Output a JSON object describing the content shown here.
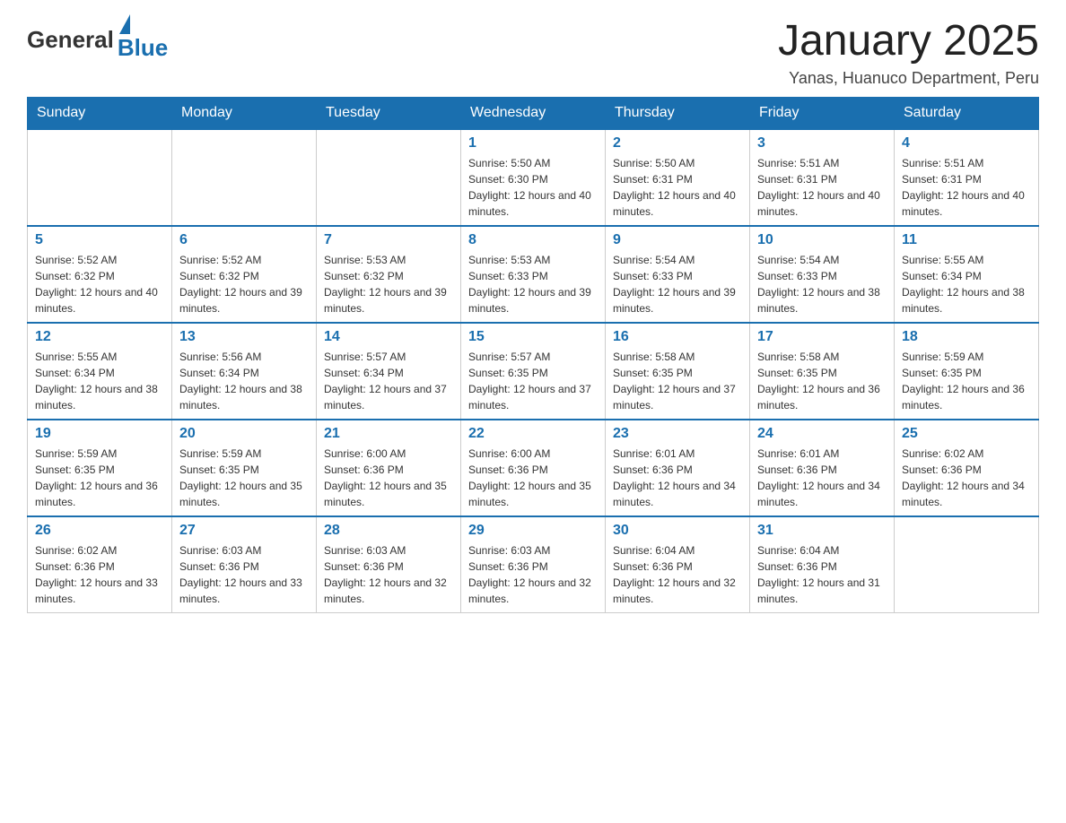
{
  "header": {
    "logo_general": "General",
    "logo_blue": "Blue",
    "title": "January 2025",
    "subtitle": "Yanas, Huanuco Department, Peru"
  },
  "columns": [
    "Sunday",
    "Monday",
    "Tuesday",
    "Wednesday",
    "Thursday",
    "Friday",
    "Saturday"
  ],
  "weeks": [
    [
      {
        "day": "",
        "info": ""
      },
      {
        "day": "",
        "info": ""
      },
      {
        "day": "",
        "info": ""
      },
      {
        "day": "1",
        "info": "Sunrise: 5:50 AM\nSunset: 6:30 PM\nDaylight: 12 hours and 40 minutes."
      },
      {
        "day": "2",
        "info": "Sunrise: 5:50 AM\nSunset: 6:31 PM\nDaylight: 12 hours and 40 minutes."
      },
      {
        "day": "3",
        "info": "Sunrise: 5:51 AM\nSunset: 6:31 PM\nDaylight: 12 hours and 40 minutes."
      },
      {
        "day": "4",
        "info": "Sunrise: 5:51 AM\nSunset: 6:31 PM\nDaylight: 12 hours and 40 minutes."
      }
    ],
    [
      {
        "day": "5",
        "info": "Sunrise: 5:52 AM\nSunset: 6:32 PM\nDaylight: 12 hours and 40 minutes."
      },
      {
        "day": "6",
        "info": "Sunrise: 5:52 AM\nSunset: 6:32 PM\nDaylight: 12 hours and 39 minutes."
      },
      {
        "day": "7",
        "info": "Sunrise: 5:53 AM\nSunset: 6:32 PM\nDaylight: 12 hours and 39 minutes."
      },
      {
        "day": "8",
        "info": "Sunrise: 5:53 AM\nSunset: 6:33 PM\nDaylight: 12 hours and 39 minutes."
      },
      {
        "day": "9",
        "info": "Sunrise: 5:54 AM\nSunset: 6:33 PM\nDaylight: 12 hours and 39 minutes."
      },
      {
        "day": "10",
        "info": "Sunrise: 5:54 AM\nSunset: 6:33 PM\nDaylight: 12 hours and 38 minutes."
      },
      {
        "day": "11",
        "info": "Sunrise: 5:55 AM\nSunset: 6:34 PM\nDaylight: 12 hours and 38 minutes."
      }
    ],
    [
      {
        "day": "12",
        "info": "Sunrise: 5:55 AM\nSunset: 6:34 PM\nDaylight: 12 hours and 38 minutes."
      },
      {
        "day": "13",
        "info": "Sunrise: 5:56 AM\nSunset: 6:34 PM\nDaylight: 12 hours and 38 minutes."
      },
      {
        "day": "14",
        "info": "Sunrise: 5:57 AM\nSunset: 6:34 PM\nDaylight: 12 hours and 37 minutes."
      },
      {
        "day": "15",
        "info": "Sunrise: 5:57 AM\nSunset: 6:35 PM\nDaylight: 12 hours and 37 minutes."
      },
      {
        "day": "16",
        "info": "Sunrise: 5:58 AM\nSunset: 6:35 PM\nDaylight: 12 hours and 37 minutes."
      },
      {
        "day": "17",
        "info": "Sunrise: 5:58 AM\nSunset: 6:35 PM\nDaylight: 12 hours and 36 minutes."
      },
      {
        "day": "18",
        "info": "Sunrise: 5:59 AM\nSunset: 6:35 PM\nDaylight: 12 hours and 36 minutes."
      }
    ],
    [
      {
        "day": "19",
        "info": "Sunrise: 5:59 AM\nSunset: 6:35 PM\nDaylight: 12 hours and 36 minutes."
      },
      {
        "day": "20",
        "info": "Sunrise: 5:59 AM\nSunset: 6:35 PM\nDaylight: 12 hours and 35 minutes."
      },
      {
        "day": "21",
        "info": "Sunrise: 6:00 AM\nSunset: 6:36 PM\nDaylight: 12 hours and 35 minutes."
      },
      {
        "day": "22",
        "info": "Sunrise: 6:00 AM\nSunset: 6:36 PM\nDaylight: 12 hours and 35 minutes."
      },
      {
        "day": "23",
        "info": "Sunrise: 6:01 AM\nSunset: 6:36 PM\nDaylight: 12 hours and 34 minutes."
      },
      {
        "day": "24",
        "info": "Sunrise: 6:01 AM\nSunset: 6:36 PM\nDaylight: 12 hours and 34 minutes."
      },
      {
        "day": "25",
        "info": "Sunrise: 6:02 AM\nSunset: 6:36 PM\nDaylight: 12 hours and 34 minutes."
      }
    ],
    [
      {
        "day": "26",
        "info": "Sunrise: 6:02 AM\nSunset: 6:36 PM\nDaylight: 12 hours and 33 minutes."
      },
      {
        "day": "27",
        "info": "Sunrise: 6:03 AM\nSunset: 6:36 PM\nDaylight: 12 hours and 33 minutes."
      },
      {
        "day": "28",
        "info": "Sunrise: 6:03 AM\nSunset: 6:36 PM\nDaylight: 12 hours and 32 minutes."
      },
      {
        "day": "29",
        "info": "Sunrise: 6:03 AM\nSunset: 6:36 PM\nDaylight: 12 hours and 32 minutes."
      },
      {
        "day": "30",
        "info": "Sunrise: 6:04 AM\nSunset: 6:36 PM\nDaylight: 12 hours and 32 minutes."
      },
      {
        "day": "31",
        "info": "Sunrise: 6:04 AM\nSunset: 6:36 PM\nDaylight: 12 hours and 31 minutes."
      },
      {
        "day": "",
        "info": ""
      }
    ]
  ]
}
